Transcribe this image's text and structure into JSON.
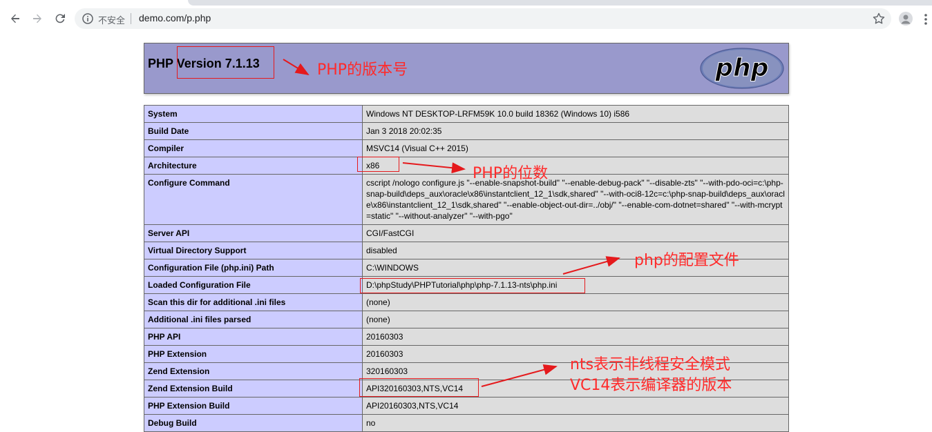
{
  "browser": {
    "security_label": "不安全",
    "url": "demo.com/p.php"
  },
  "header": {
    "title": "PHP Version 7.1.13",
    "logo_text": "php"
  },
  "rows": [
    {
      "key": "System",
      "value": "Windows NT DESKTOP-LRFM59K 10.0 build 18362 (Windows 10) i586"
    },
    {
      "key": "Build Date",
      "value": "Jan 3 2018 20:02:35"
    },
    {
      "key": "Compiler",
      "value": "MSVC14 (Visual C++ 2015)"
    },
    {
      "key": "Architecture",
      "value": "x86"
    },
    {
      "key": "Configure Command",
      "value": "cscript /nologo configure.js \"--enable-snapshot-build\" \"--enable-debug-pack\" \"--disable-zts\" \"--with-pdo-oci=c:\\php-snap-build\\deps_aux\\oracle\\x86\\instantclient_12_1\\sdk,shared\" \"--with-oci8-12c=c:\\php-snap-build\\deps_aux\\oracle\\x86\\instantclient_12_1\\sdk,shared\" \"--enable-object-out-dir=../obj/\" \"--enable-com-dotnet=shared\" \"--with-mcrypt=static\" \"--without-analyzer\" \"--with-pgo\""
    },
    {
      "key": "Server API",
      "value": "CGI/FastCGI"
    },
    {
      "key": "Virtual Directory Support",
      "value": "disabled"
    },
    {
      "key": "Configuration File (php.ini) Path",
      "value": "C:\\WINDOWS"
    },
    {
      "key": "Loaded Configuration File",
      "value": "D:\\phpStudy\\PHPTutorial\\php\\php-7.1.13-nts\\php.ini"
    },
    {
      "key": "Scan this dir for additional .ini files",
      "value": "(none)"
    },
    {
      "key": "Additional .ini files parsed",
      "value": "(none)"
    },
    {
      "key": "PHP API",
      "value": "20160303"
    },
    {
      "key": "PHP Extension",
      "value": "20160303"
    },
    {
      "key": "Zend Extension",
      "value": "320160303"
    },
    {
      "key": "Zend Extension Build",
      "value": "API320160303,NTS,VC14"
    },
    {
      "key": "PHP Extension Build",
      "value": "API20160303,NTS,VC14"
    },
    {
      "key": "Debug Build",
      "value": "no"
    }
  ],
  "annotations": {
    "version": "PHP的版本号",
    "bits": "PHP的位数",
    "config": "php的配置文件",
    "nts_line1": "nts表示非线程安全模式",
    "nts_line2": "VC14表示编译器的版本"
  },
  "colors": {
    "header_bg": "#9999cc",
    "key_bg": "#ccccff",
    "value_bg": "#dddddd",
    "annotation": "#ff2a2a"
  }
}
